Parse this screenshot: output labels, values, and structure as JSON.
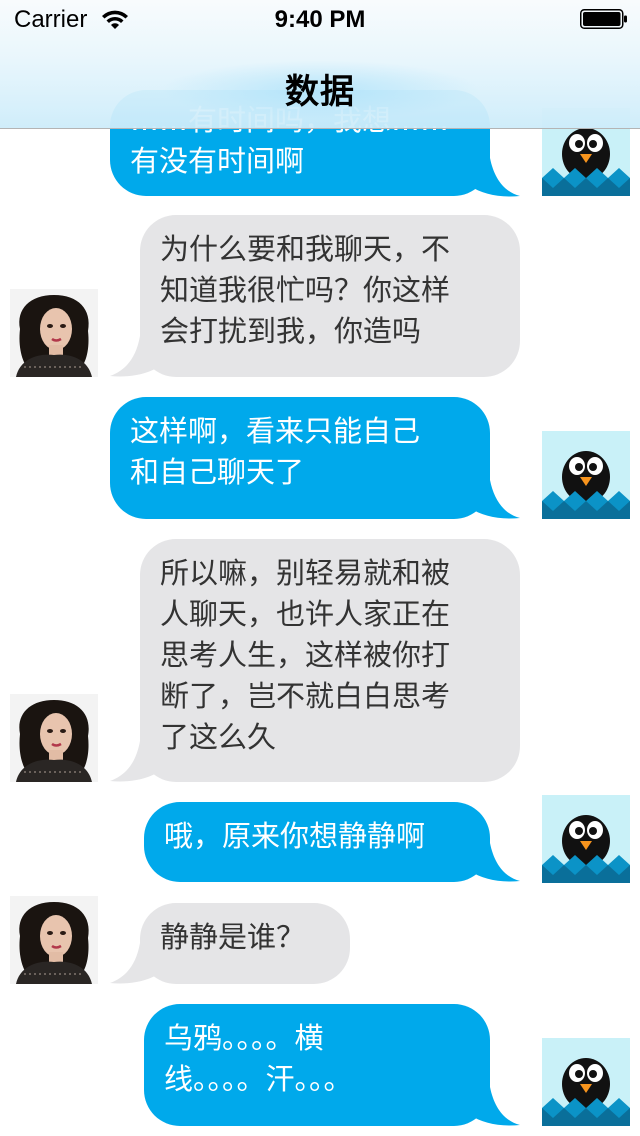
{
  "status_bar": {
    "carrier": "Carrier",
    "time": "9:40 PM"
  },
  "nav": {
    "title": "数据"
  },
  "messages": [
    {
      "from": "me",
      "lines": [
        "……有时间吗，我想……",
        "有没有时间啊"
      ],
      "text": "有没有时间啊"
    },
    {
      "from": "other",
      "lines": [
        "为什么要和我聊天，不",
        "知道我很忙吗？你这样",
        "会打扰到我，你造吗"
      ]
    },
    {
      "from": "me",
      "lines": [
        "这样啊，看来只能自己",
        "和自己聊天了"
      ]
    },
    {
      "from": "other",
      "lines": [
        "所以嘛，别轻易就和被",
        "人聊天，也许人家正在",
        "思考人生，这样被你打",
        "断了，岂不就白白思考",
        "了这么久"
      ]
    },
    {
      "from": "me",
      "lines": [
        "哦，原来你想静静啊"
      ]
    },
    {
      "from": "other",
      "lines": [
        "静静是谁？"
      ]
    },
    {
      "from": "me",
      "lines": [
        "乌鸦。。。。横",
        "线。。。。汗。。。"
      ]
    }
  ],
  "colors": {
    "me_bubble": "#00a9eb",
    "other_bubble": "#e5e5e7",
    "me_text": "#ffffff",
    "other_text": "#333333"
  },
  "icons": {
    "me_avatar": "penguin-avatar-icon",
    "other_avatar": "woman-photo-avatar"
  }
}
